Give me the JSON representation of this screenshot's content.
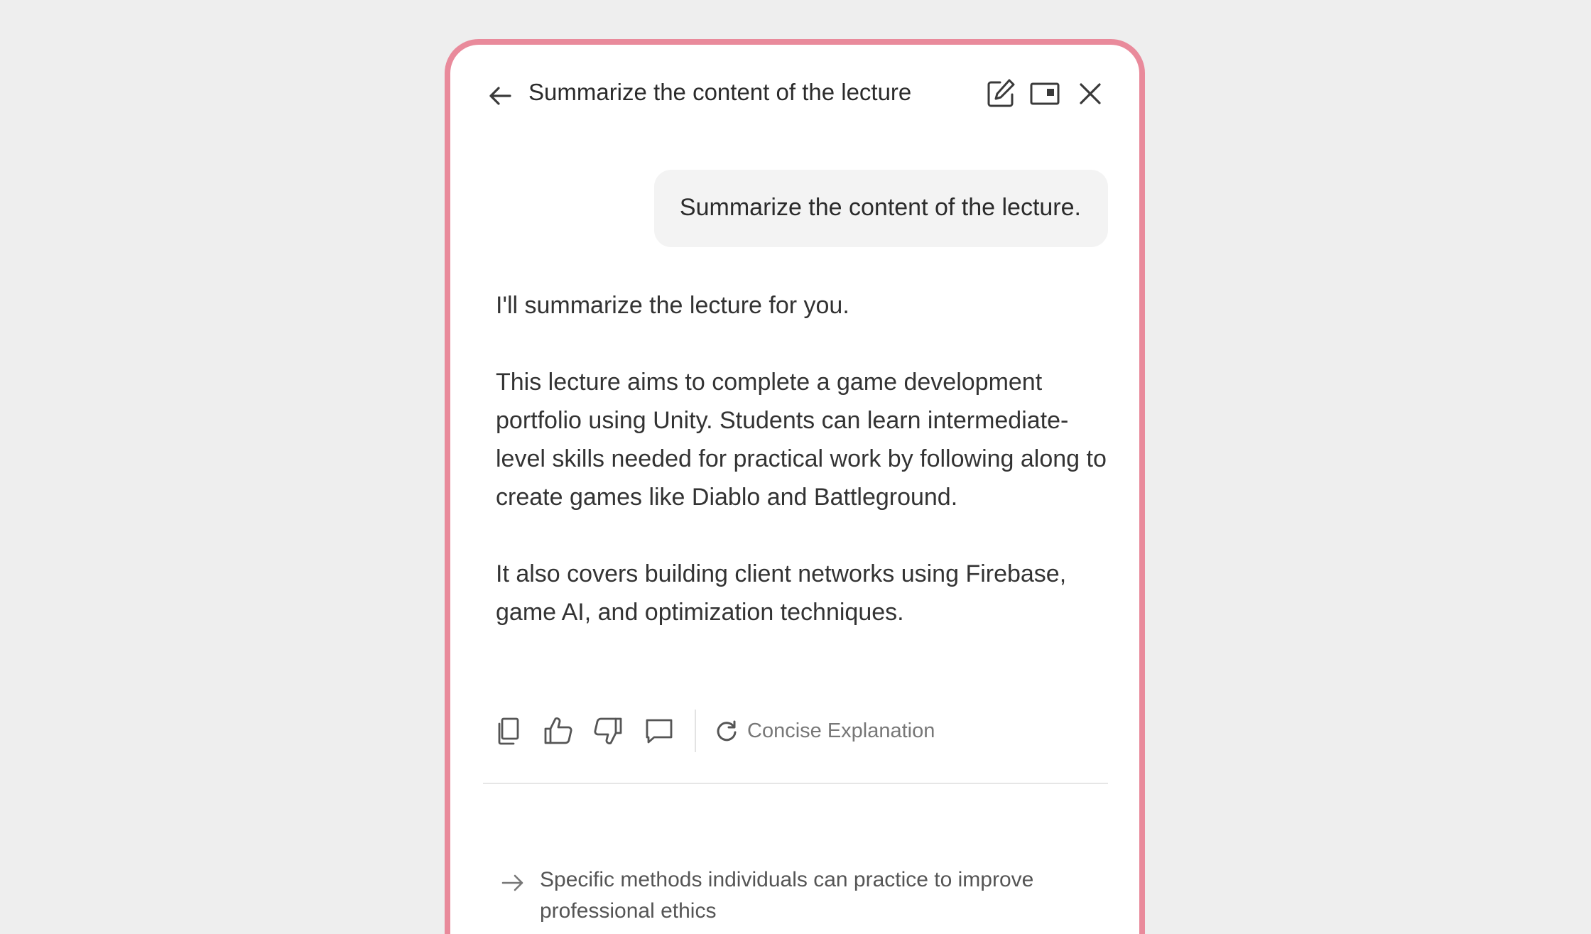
{
  "header": {
    "title": "Summarize the content of the lecture",
    "icons": [
      "back-arrow-icon",
      "edit-icon",
      "picture-in-picture-icon",
      "close-icon"
    ]
  },
  "conversation": {
    "user_message": "Summarize the content of the lecture.",
    "assistant_paragraphs": [
      "I'll summarize the lecture for you.",
      "This lecture aims to complete a game development portfolio using Unity. Students can learn intermediate-level skills needed for practical work by following along to create games like Diablo and Battleground.",
      "It also covers building client networks using Firebase, game AI, and optimization techniques."
    ]
  },
  "actions": {
    "icons": [
      "copy-icon",
      "thumbs-up-icon",
      "thumbs-down-icon",
      "comment-icon",
      "refresh-icon"
    ],
    "concise_label": "Concise Explanation"
  },
  "suggestion": {
    "text": "Specific methods individuals can practice to improve professional ethics"
  },
  "colors": {
    "background": "#eeeeee",
    "panel_border": "#e98a9b",
    "bubble": "#f3f3f3",
    "text": "#333333",
    "muted": "#777777"
  }
}
